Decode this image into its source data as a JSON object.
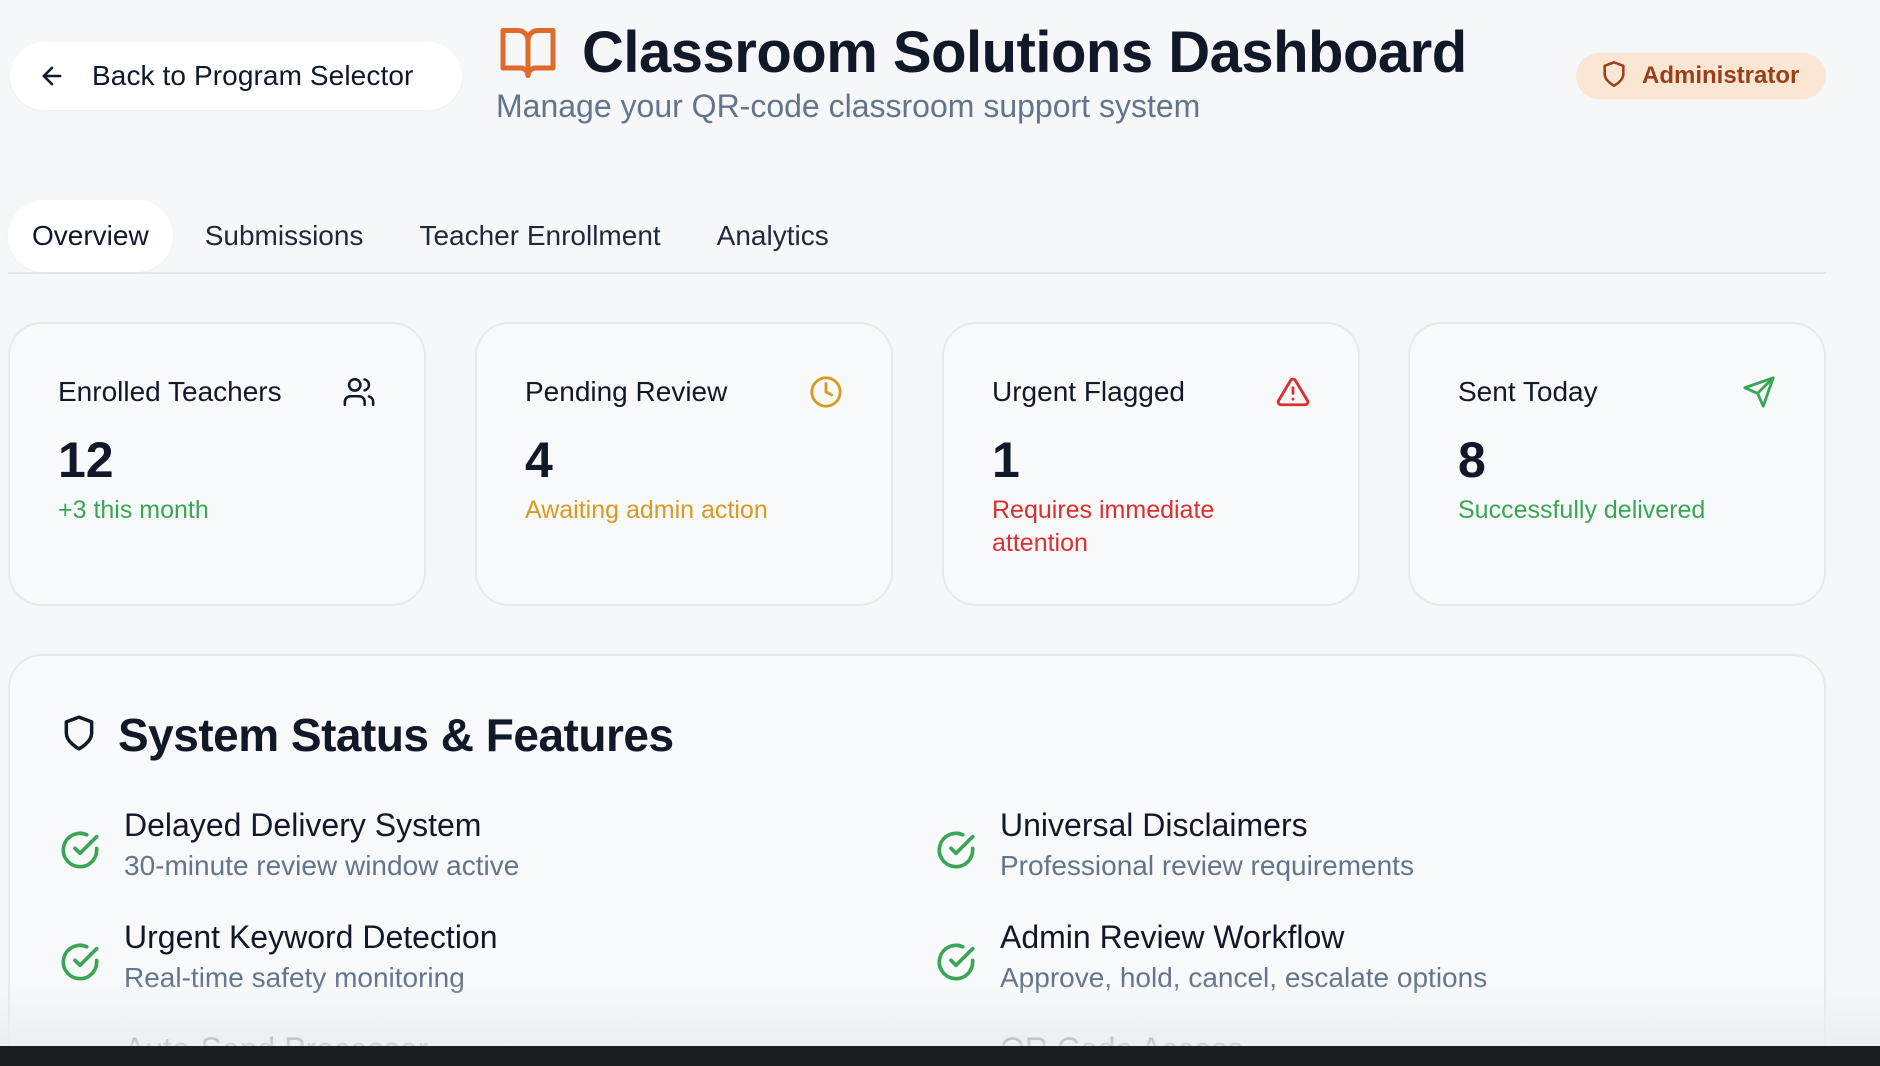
{
  "header": {
    "back_label": "Back to Program Selector",
    "title": "Classroom Solutions Dashboard",
    "subtitle": "Manage your QR-code classroom support system",
    "role": "Administrator"
  },
  "tabs": [
    {
      "label": "Overview",
      "active": true
    },
    {
      "label": "Submissions",
      "active": false
    },
    {
      "label": "Teacher Enrollment",
      "active": false
    },
    {
      "label": "Analytics",
      "active": false
    }
  ],
  "stats": [
    {
      "label": "Enrolled Teachers",
      "value": "12",
      "note": "+3 this month",
      "icon": "users-icon",
      "color": "#3aa655"
    },
    {
      "label": "Pending Review",
      "value": "4",
      "note": "Awaiting admin action",
      "icon": "clock-icon",
      "color": "#d99a22"
    },
    {
      "label": "Urgent Flagged",
      "value": "1",
      "note": "Requires immediate attention",
      "icon": "alert-triangle-icon",
      "color": "#dc2f2f"
    },
    {
      "label": "Sent Today",
      "value": "8",
      "note": "Successfully delivered",
      "icon": "send-icon",
      "color": "#3aa655"
    }
  ],
  "system_status": {
    "title": "System Status & Features",
    "features": [
      {
        "title": "Delayed Delivery System",
        "desc": "30-minute review window active"
      },
      {
        "title": "Universal Disclaimers",
        "desc": "Professional review requirements"
      },
      {
        "title": "Urgent Keyword Detection",
        "desc": "Real-time safety monitoring"
      },
      {
        "title": "Admin Review Workflow",
        "desc": "Approve, hold, cancel, escalate options"
      },
      {
        "title": "Auto-Send Processor",
        "desc": ""
      },
      {
        "title": "QR Code Access",
        "desc": ""
      }
    ]
  },
  "colors": {
    "brand": "#e06a2c",
    "success": "#3aa655",
    "warning": "#d99a22",
    "danger": "#dc2f2f",
    "badge_bg": "#fbe6d4",
    "badge_text": "#9a3f1c"
  }
}
